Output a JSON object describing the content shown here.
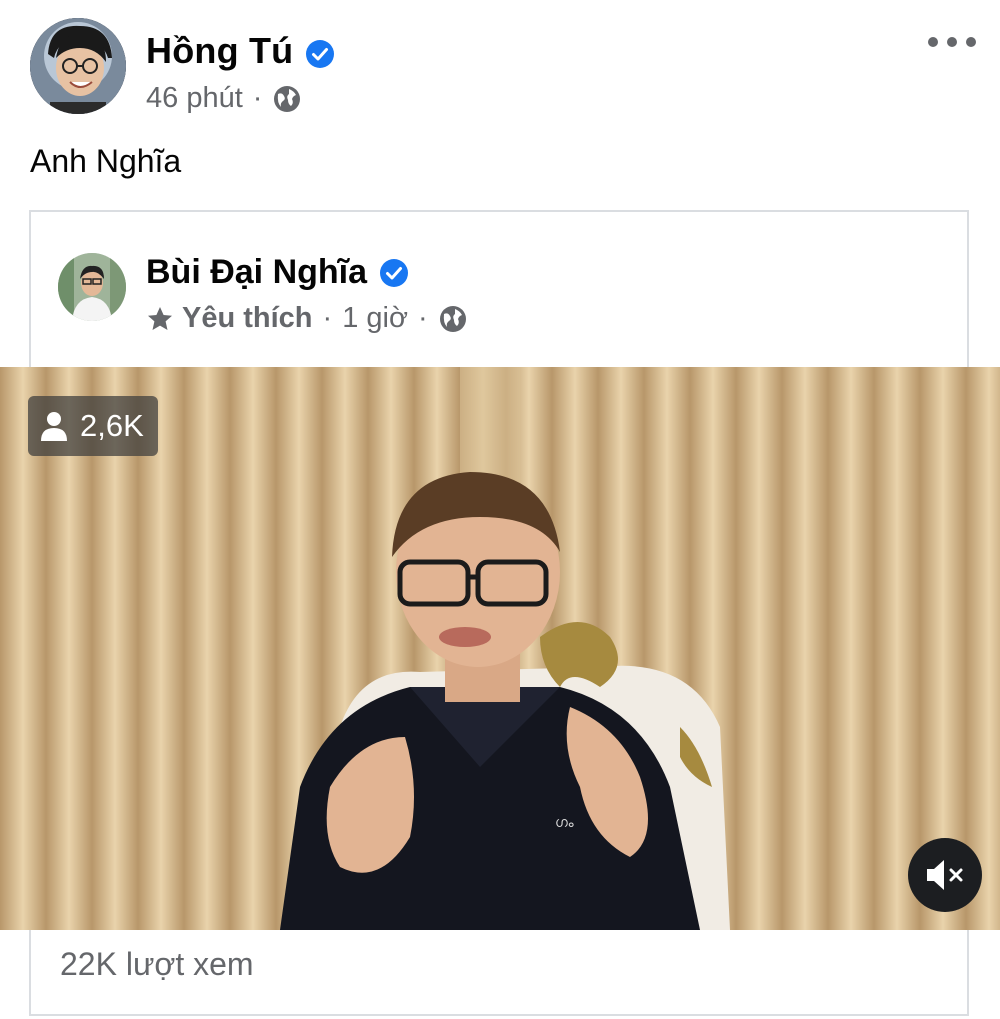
{
  "post": {
    "author": "Hồng Tú",
    "time": "46 phút",
    "separator": "·",
    "text": "Anh Nghĩa"
  },
  "shared": {
    "author": "Bùi Đại Nghĩa",
    "tag": "Yêu thích",
    "time": "1 giờ",
    "separator": "·"
  },
  "video": {
    "viewers": "2,6K",
    "views": "22K lượt xem"
  },
  "icons": {
    "verified": "verified-badge-icon",
    "privacy": "globe-icon",
    "favorite": "star-icon",
    "viewers": "person-icon",
    "mute": "speaker-muted-icon",
    "more": "more-dots-icon"
  },
  "colors": {
    "verified": "#1877f2",
    "meta_text": "#65676b",
    "card_border": "#dadde1"
  }
}
